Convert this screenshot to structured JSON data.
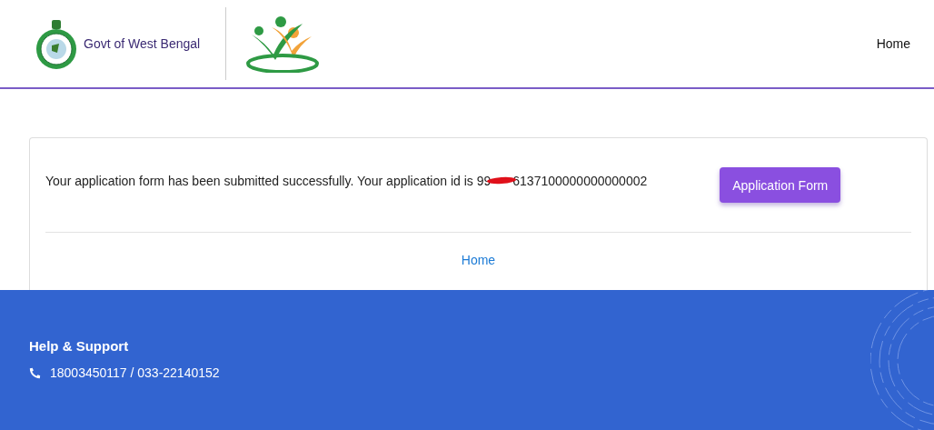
{
  "header": {
    "brand": "Govt of West Bengal",
    "nav": [
      {
        "label": "Home"
      }
    ]
  },
  "card": {
    "message": "Your application form has been submitted successfully. Your application id is 99",
    "id_tail": "6137100000000000002",
    "button": "Application Form",
    "link": "Home"
  },
  "footer": {
    "heading": "Help & Support",
    "phone": "18003450117 / 033-22140152"
  }
}
